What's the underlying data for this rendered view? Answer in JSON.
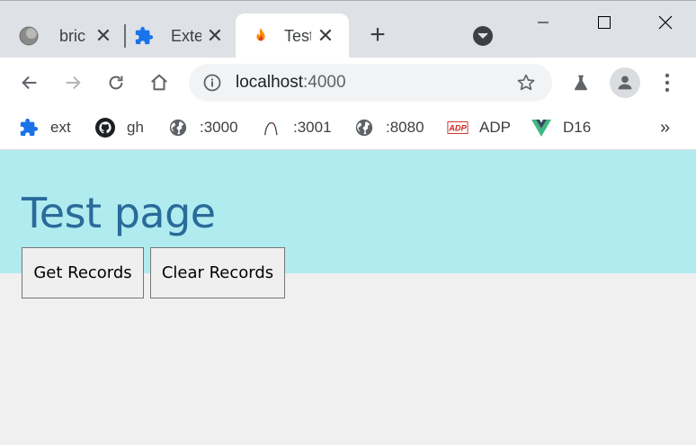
{
  "tabs": [
    {
      "title": "bric",
      "icon": "globe-icon"
    },
    {
      "title": "Exte",
      "icon": "puzzle-icon"
    },
    {
      "title": "Test",
      "icon": "fire-icon",
      "active": true
    }
  ],
  "toolbar": {
    "url_host": "localhost",
    "url_port": ":4000"
  },
  "bookmarks": [
    {
      "label": "ext",
      "icon": "puzzle-icon"
    },
    {
      "label": "gh",
      "icon": "github-icon"
    },
    {
      "label": ":3000",
      "icon": "globe-icon"
    },
    {
      "label": ":3001",
      "icon": "arc-icon"
    },
    {
      "label": ":8080",
      "icon": "globe-icon"
    },
    {
      "label": "ADP",
      "icon": "adp-logo-icon"
    },
    {
      "label": "D16",
      "icon": "vue-logo-icon"
    }
  ],
  "bookmarks_overflow": "»",
  "page": {
    "title": "Test page",
    "get_records_label": "Get Records",
    "clear_records_label": "Clear Records"
  },
  "colors": {
    "header_bg": "#b0ebef",
    "title_color": "#2a6b9a",
    "page_bg": "#f0f0f0"
  }
}
